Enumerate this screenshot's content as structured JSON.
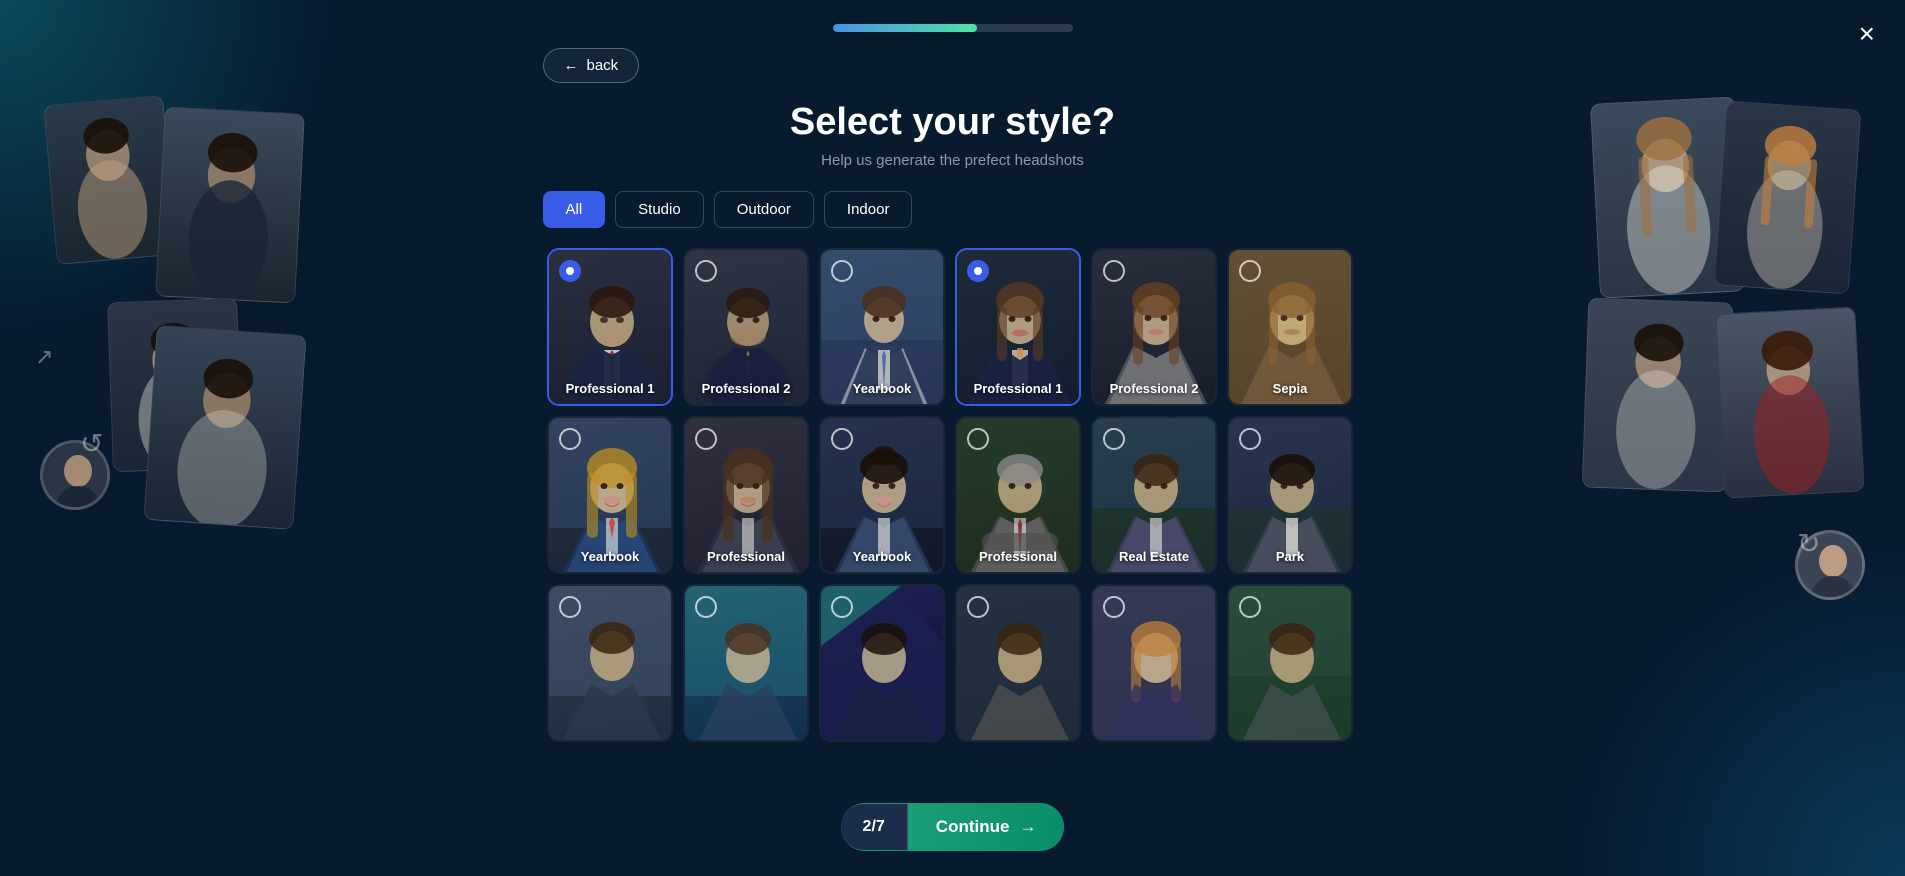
{
  "header": {
    "progress": 60,
    "title": "Select your style?",
    "subtitle": "Help us generate the prefect headshots",
    "back_label": "back",
    "close_label": "×"
  },
  "filters": {
    "tabs": [
      {
        "id": "all",
        "label": "All",
        "active": true
      },
      {
        "id": "studio",
        "label": "Studio",
        "active": false
      },
      {
        "id": "outdoor",
        "label": "Outdoor",
        "active": false
      },
      {
        "id": "indoor",
        "label": "Indoor",
        "active": false
      }
    ]
  },
  "grid": {
    "row1": [
      {
        "id": "pro1",
        "label": "Professional 1",
        "selected": true,
        "bg_class": "card-1-bg"
      },
      {
        "id": "pro2",
        "label": "Professional 2",
        "selected": false,
        "bg_class": "card-2-bg"
      },
      {
        "id": "yb1",
        "label": "Yearbook",
        "selected": false,
        "bg_class": "card-3-bg"
      },
      {
        "id": "pro1f",
        "label": "Professional 1",
        "selected": true,
        "bg_class": "card-4-bg"
      },
      {
        "id": "pro2f",
        "label": "Professional 2",
        "selected": false,
        "bg_class": "card-5-bg"
      },
      {
        "id": "sepia",
        "label": "Sepia",
        "selected": false,
        "bg_class": "card-6-bg"
      }
    ],
    "row2": [
      {
        "id": "yb2",
        "label": "Yearbook",
        "selected": false,
        "bg_class": "card-7-bg"
      },
      {
        "id": "pro3",
        "label": "Professional",
        "selected": false,
        "bg_class": "card-8-bg"
      },
      {
        "id": "yb3",
        "label": "Yearbook",
        "selected": false,
        "bg_class": "card-9-bg"
      },
      {
        "id": "pro4",
        "label": "Professional",
        "selected": false,
        "bg_class": "card-10-bg"
      },
      {
        "id": "realestate",
        "label": "Real Estate",
        "selected": false,
        "bg_class": "card-11-bg"
      },
      {
        "id": "park",
        "label": "Park",
        "selected": false,
        "bg_class": "card-12-bg"
      }
    ],
    "row3": [
      {
        "id": "b1",
        "label": "",
        "selected": false,
        "bg_class": "card-b1-bg"
      },
      {
        "id": "b2",
        "label": "",
        "selected": false,
        "bg_class": "card-b2-bg"
      },
      {
        "id": "b3",
        "label": "",
        "selected": false,
        "bg_class": "card-b3-bg"
      },
      {
        "id": "b4",
        "label": "",
        "selected": false,
        "bg_class": "card-b4-bg"
      },
      {
        "id": "b5",
        "label": "",
        "selected": false,
        "bg_class": "card-b5-bg"
      },
      {
        "id": "b6",
        "label": "",
        "selected": false,
        "bg_class": "card-b6-bg"
      }
    ]
  },
  "footer": {
    "step_current": "2",
    "step_total": "7",
    "step_display": "2/7",
    "continue_label": "Continue",
    "arrow": "→"
  }
}
